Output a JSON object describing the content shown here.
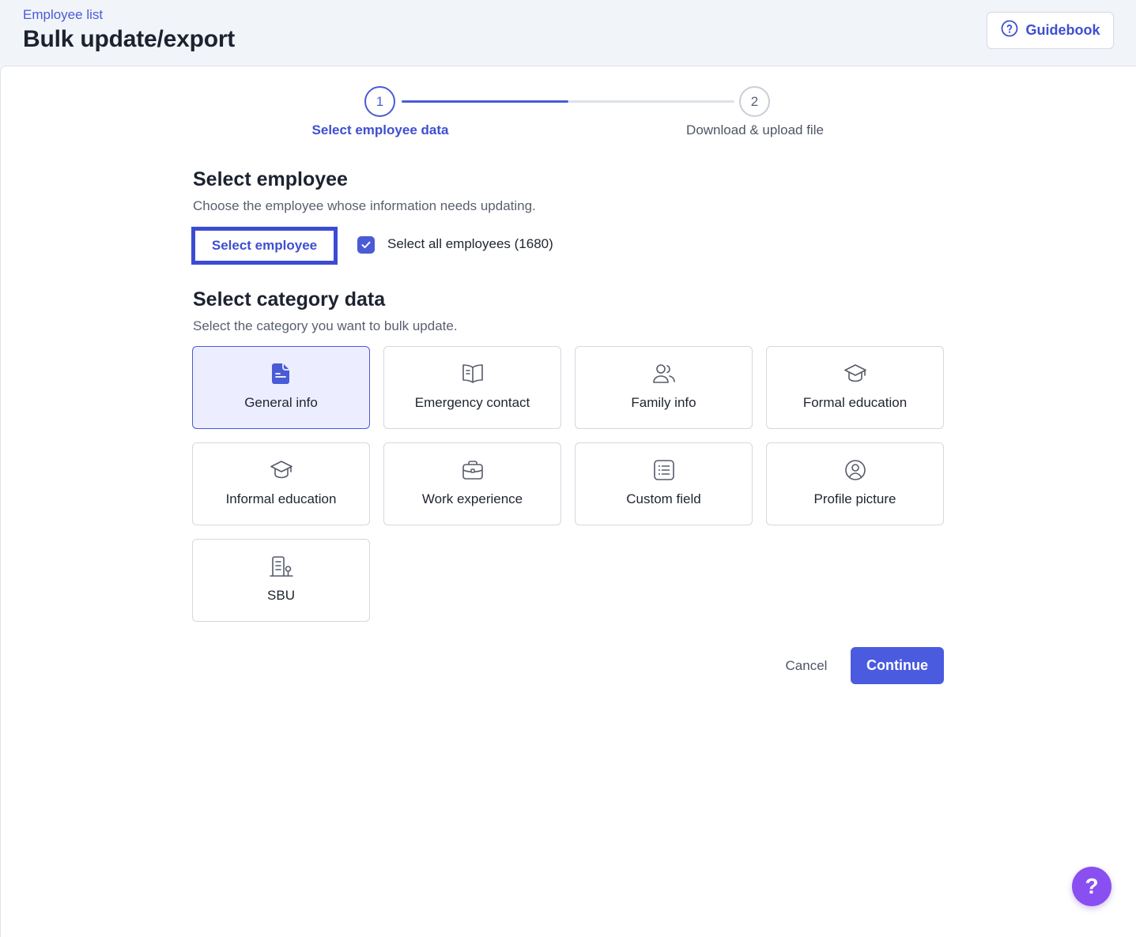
{
  "header": {
    "breadcrumb": "Employee list",
    "title": "Bulk update/export",
    "guidebook_label": "Guidebook"
  },
  "stepper": {
    "steps": [
      {
        "number": "1",
        "label": "Select employee data",
        "state": "active"
      },
      {
        "number": "2",
        "label": "Download & upload file",
        "state": "pending"
      }
    ],
    "progress": 0.5
  },
  "select_employee": {
    "title": "Select employee",
    "description": "Choose the employee whose information needs updating.",
    "button_label": "Select employee",
    "select_all_label": "Select all employees (1680)",
    "select_all_checked": true
  },
  "category": {
    "title": "Select category data",
    "description": "Select the category you want to bulk update.",
    "items": [
      {
        "label": "General info",
        "icon": "document-icon",
        "selected": true
      },
      {
        "label": "Emergency contact",
        "icon": "book-icon",
        "selected": false
      },
      {
        "label": "Family info",
        "icon": "users-icon",
        "selected": false
      },
      {
        "label": "Formal education",
        "icon": "graduation-cap-icon",
        "selected": false
      },
      {
        "label": "Informal education",
        "icon": "graduation-cap-icon",
        "selected": false
      },
      {
        "label": "Work experience",
        "icon": "briefcase-icon",
        "selected": false
      },
      {
        "label": "Custom field",
        "icon": "list-icon",
        "selected": false
      },
      {
        "label": "Profile picture",
        "icon": "user-circle-icon",
        "selected": false
      },
      {
        "label": "SBU",
        "icon": "building-icon",
        "selected": false
      }
    ]
  },
  "actions": {
    "cancel_label": "Cancel",
    "continue_label": "Continue"
  },
  "help": {
    "icon": "question-icon",
    "symbol": "?"
  },
  "colors": {
    "accent": "#4a5bd6",
    "selected_card_bg": "#eceeff",
    "help_fab": "#8a4ff0"
  }
}
